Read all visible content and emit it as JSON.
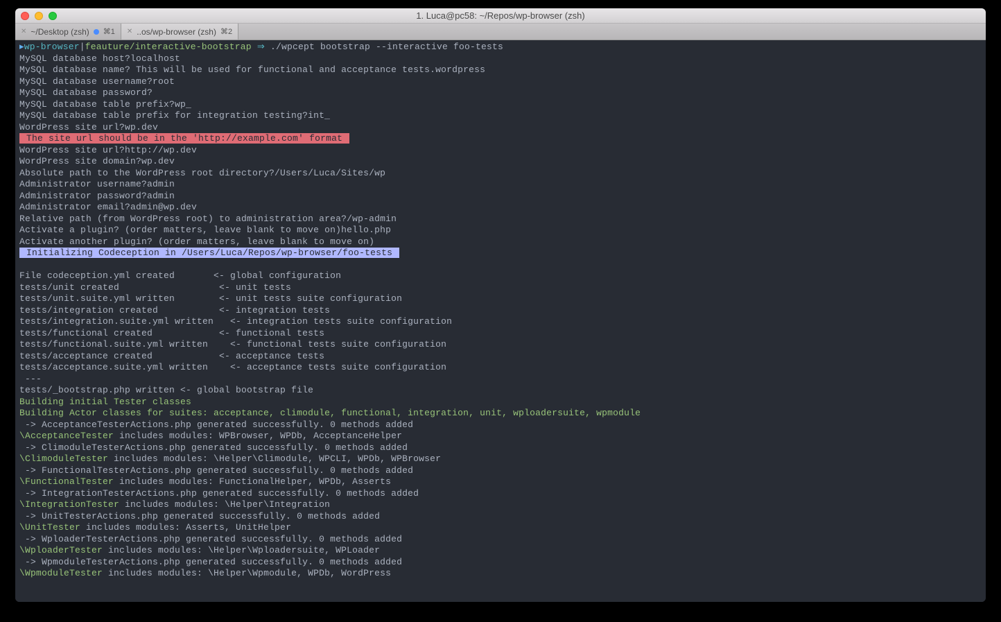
{
  "window": {
    "title": "1. Luca@pc58: ~/Repos/wp-browser (zsh)"
  },
  "tabs": [
    {
      "label": "~/Desktop (zsh)",
      "shortcut": "⌘1",
      "has_dot": true
    },
    {
      "label": "..os/wp-browser (zsh)",
      "shortcut": "⌘2",
      "has_dot": false
    }
  ],
  "prompt": {
    "path": "wp-browser",
    "branch": "feauture/interactive-bootstrap",
    "arrow": "⇒",
    "command": "./wpcept bootstrap --interactive foo-tests"
  },
  "qa": [
    "MySQL database host?localhost",
    "MySQL database name? This will be used for functional and acceptance tests.wordpress",
    "MySQL database username?root",
    "MySQL database password?",
    "MySQL database table prefix?wp_",
    "MySQL database table prefix for integration testing?int_",
    "WordPress site url?wp.dev"
  ],
  "error_msg": " The site url should be in the 'http://example.com' format ",
  "qa2": [
    "WordPress site url?http://wp.dev",
    "WordPress site domain?wp.dev",
    "Absolute path to the WordPress root directory?/Users/Luca/Sites/wp",
    "Administrator username?admin",
    "Administrator password?admin",
    "Administrator email?admin@wp.dev",
    "Relative path (from WordPress root) to administration area?/wp-admin",
    "Activate a plugin? (order matters, leave blank to move on)hello.php",
    "Activate another plugin? (order matters, leave blank to move on)"
  ],
  "init_msg": " Initializing Codeception in /Users/Luca/Repos/wp-browser/foo-tests ",
  "created": [
    "File codeception.yml created       <- global configuration",
    "tests/unit created                  <- unit tests",
    "tests/unit.suite.yml written        <- unit tests suite configuration",
    "tests/integration created           <- integration tests",
    "tests/integration.suite.yml written   <- integration tests suite configuration",
    "tests/functional created            <- functional tests",
    "tests/functional.suite.yml written    <- functional tests suite configuration",
    "tests/acceptance created            <- acceptance tests",
    "tests/acceptance.suite.yml written    <- acceptance tests suite configuration",
    " ---",
    "tests/_bootstrap.php written <- global bootstrap file"
  ],
  "building": [
    "Building initial Tester classes",
    "Building Actor classes for suites: acceptance, climodule, functional, integration, unit, wploadersuite, wpmodule"
  ],
  "testers": [
    {
      "gen": " -> AcceptanceTesterActions.php generated successfully. 0 methods added",
      "name": "\\AcceptanceTester",
      "modules": " includes modules: WPBrowser, WPDb, AcceptanceHelper"
    },
    {
      "gen": " -> ClimoduleTesterActions.php generated successfully. 0 methods added",
      "name": "\\ClimoduleTester",
      "modules": " includes modules: \\Helper\\Climodule, WPCLI, WPDb, WPBrowser"
    },
    {
      "gen": " -> FunctionalTesterActions.php generated successfully. 0 methods added",
      "name": "\\FunctionalTester",
      "modules": " includes modules: FunctionalHelper, WPDb, Asserts"
    },
    {
      "gen": " -> IntegrationTesterActions.php generated successfully. 0 methods added",
      "name": "\\IntegrationTester",
      "modules": " includes modules: \\Helper\\Integration"
    },
    {
      "gen": " -> UnitTesterActions.php generated successfully. 0 methods added",
      "name": "\\UnitTester",
      "modules": " includes modules: Asserts, UnitHelper"
    },
    {
      "gen": " -> WploaderTesterActions.php generated successfully. 0 methods added",
      "name": "\\WploaderTester",
      "modules": " includes modules: \\Helper\\Wploadersuite, WPLoader"
    },
    {
      "gen": " -> WpmoduleTesterActions.php generated successfully. 0 methods added",
      "name": "\\WpmoduleTester",
      "modules": " includes modules: \\Helper\\Wpmodule, WPDb, WordPress"
    }
  ]
}
